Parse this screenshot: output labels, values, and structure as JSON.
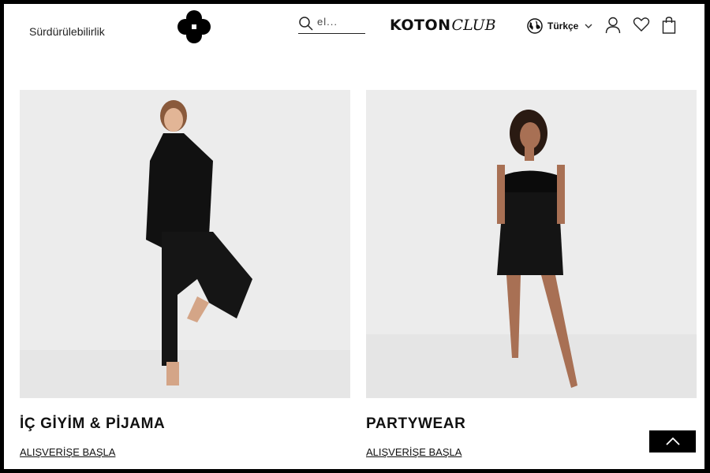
{
  "header": {
    "sustainability_link": "Sürdürülebilirlik",
    "logo_icon": "clover-logo-icon",
    "search": {
      "placeholder": "el...",
      "icon": "search-icon"
    },
    "brand": {
      "koton": "KOTON",
      "club": "CLUB"
    },
    "language": {
      "label": "Türkçe",
      "icon": "globe-icon",
      "chevron": "chevron-down-icon"
    },
    "account_icon": "user-icon",
    "wishlist_icon": "heart-icon",
    "cart_icon": "shopping-bag-icon"
  },
  "cards": [
    {
      "title": "İÇ GİYİM & PİJAMA",
      "link": "ALIŞVERİŞE BAŞLA",
      "image": "woman-black-satin-pajamas-photo"
    },
    {
      "title": "PARTYWEAR",
      "link": "ALIŞVERİŞE BAŞLA",
      "image": "woman-black-feather-strapless-dress-photo"
    }
  ],
  "scroll_top_icon": "chevron-up-icon",
  "colors": {
    "text": "#111111",
    "background": "#ffffff",
    "image_bg": "#ececec",
    "accent": "#000000"
  }
}
